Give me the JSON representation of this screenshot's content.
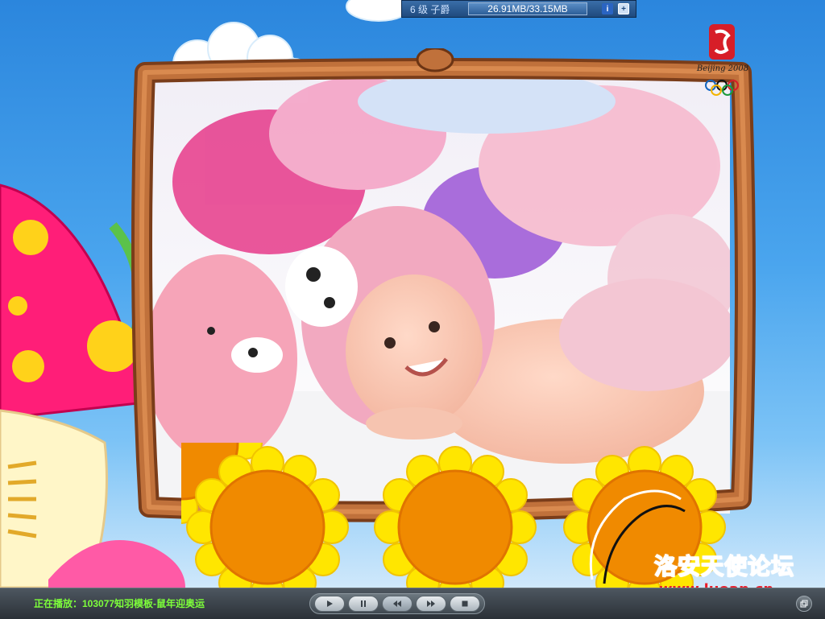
{
  "topbar": {
    "level_label": "6 级 子爵",
    "memory_usage": "26.91MB/33.15MB",
    "icons": [
      "info-icon",
      "expand-icon"
    ]
  },
  "artwork": {
    "olympic_logo_text": "Beijing 2008"
  },
  "watermark": {
    "name": "洛安天使论坛",
    "url": "www.luoan.cn"
  },
  "controlbar": {
    "now_playing": "正在播放：103077知羽模板-鼠年迎奥运",
    "buttons": [
      "play",
      "pause",
      "rewind",
      "fast-forward",
      "stop"
    ],
    "active_button": "rewind"
  },
  "colors": {
    "sky": "#2b86dd",
    "frame_wood": "#a0522d",
    "sunflower_petal": "#ffe600",
    "sunflower_center": "#f08a00",
    "now_playing_text": "#7dff3a",
    "watermark": "#ff3355"
  }
}
